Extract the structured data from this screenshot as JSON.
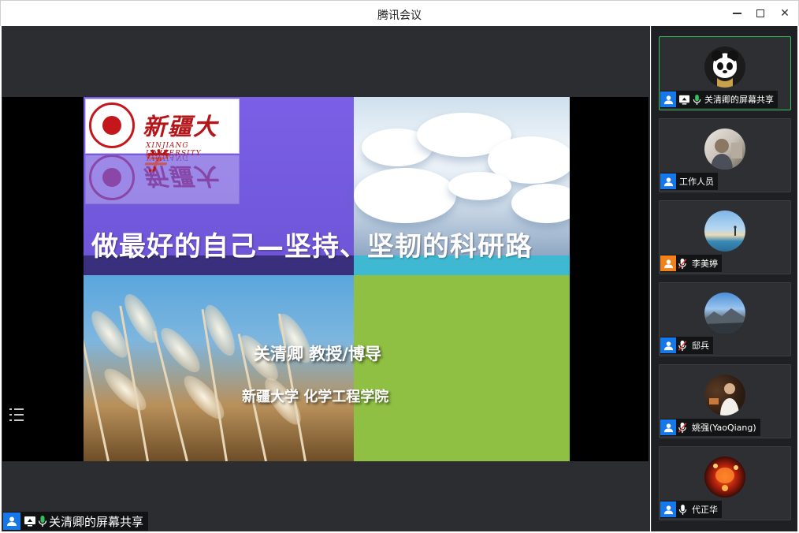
{
  "window": {
    "title": "腾讯会议",
    "min_icon": "minimize-icon",
    "max_icon": "maximize-icon",
    "close_icon": "close-icon",
    "close_glyph": "✕"
  },
  "slide": {
    "logo_cn": "新疆大学",
    "logo_en": "XINJIANG UNIVERSITY",
    "title": "做最好的自己—坚持、坚韧的科研路",
    "author": "关清卿 教授/博导",
    "school": "新疆大学 化学工程学院"
  },
  "stage": {
    "share_label": "关清卿的屏幕共享",
    "list_icon": "list-icon"
  },
  "participants": [
    {
      "name": "关清卿的屏幕共享",
      "active": true,
      "mic": "on",
      "screen": true,
      "avatar": "panda",
      "icon_color": "#1677e8"
    },
    {
      "name": "工作人员",
      "active": false,
      "mic": "none",
      "screen": false,
      "avatar": "person",
      "icon_color": "#1677e8"
    },
    {
      "name": "李美婷",
      "active": false,
      "mic": "muted",
      "screen": false,
      "avatar": "lake",
      "icon_color": "#f0821c"
    },
    {
      "name": "邸兵",
      "active": false,
      "mic": "muted",
      "screen": false,
      "avatar": "mountain",
      "icon_color": "#1677e8"
    },
    {
      "name": "姚强(YaoQiang)",
      "active": false,
      "mic": "muted",
      "screen": false,
      "avatar": "speaker",
      "icon_color": "#1677e8"
    },
    {
      "name": "代正华",
      "active": false,
      "mic": "on",
      "screen": false,
      "avatar": "lantern",
      "icon_color": "#1677e8"
    }
  ]
}
